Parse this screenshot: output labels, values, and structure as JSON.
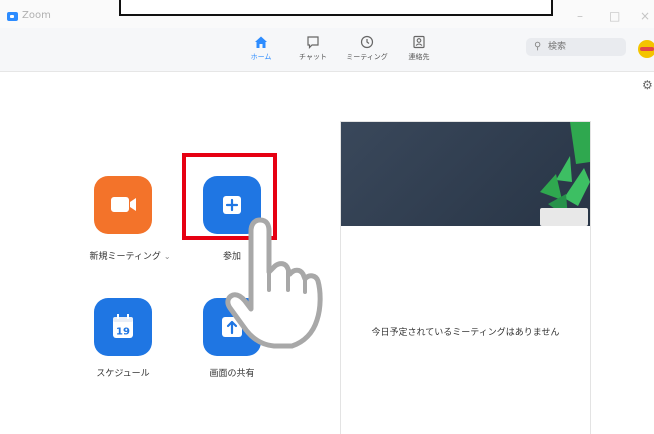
{
  "window": {
    "title": "Zoom",
    "minimize": "–",
    "maximize": "□",
    "close": "×"
  },
  "nav": {
    "items": [
      {
        "label": "ホーム",
        "icon": "home-icon",
        "active": true
      },
      {
        "label": "チャット",
        "icon": "chat-icon",
        "active": false
      },
      {
        "label": "ミーティング",
        "icon": "clock-icon",
        "active": false
      },
      {
        "label": "連絡先",
        "icon": "contacts-icon",
        "active": false
      }
    ],
    "search_placeholder": "検索"
  },
  "actions": {
    "new_meeting": {
      "label": "新規ミーティング",
      "chevron": "⌄"
    },
    "join": {
      "label": "参加"
    },
    "schedule": {
      "label": "スケジュール",
      "day": "19"
    },
    "share": {
      "label": "画面の共有"
    }
  },
  "panel": {
    "empty_message": "今日予定されているミーティングはありません"
  },
  "colors": {
    "accent": "#2d8cff",
    "orange": "#f3732a",
    "blue": "#1f76e3",
    "highlight": "#e60012"
  }
}
